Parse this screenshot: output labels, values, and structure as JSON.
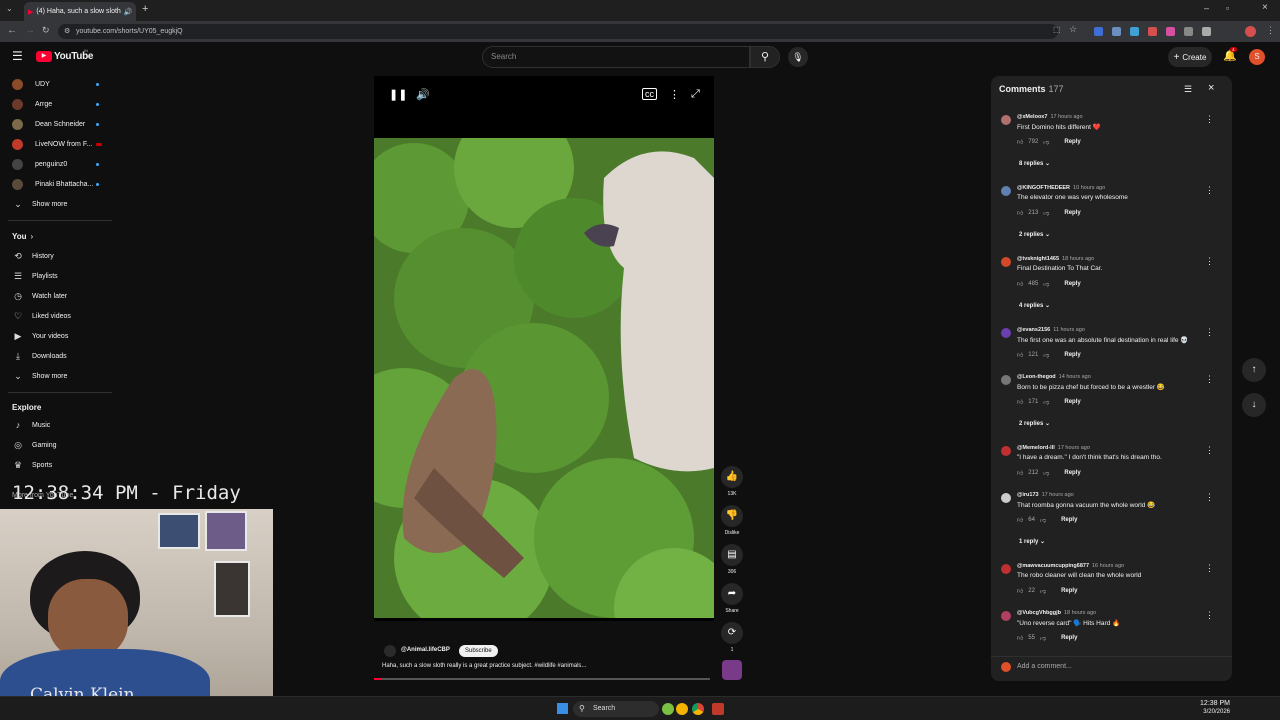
{
  "browser": {
    "tab_title": "(4) Haha, such a slow sloth",
    "url": "youtube.com/shorts/UY05_eugkjQ"
  },
  "header": {
    "logo": "YouTube",
    "logo_badge": "IN",
    "search_placeholder": "Search",
    "create_label": "Create",
    "notification_count": "4",
    "avatar_letter": "S"
  },
  "sidebar": {
    "subscriptions": [
      {
        "label": "UDY",
        "color": "#8a4b2a"
      },
      {
        "label": "Arrge",
        "color": "#6b3a2a"
      },
      {
        "label": "Dean Schneider",
        "color": "#7a6a4a"
      },
      {
        "label": "LiveNOW from F...",
        "color": "#c0392b"
      },
      {
        "label": "penguinz0",
        "color": "#444"
      },
      {
        "label": "Pinaki Bhattacha...",
        "color": "#5a4a3a"
      }
    ],
    "show_more_1": "Show more",
    "you_label": "You",
    "you_items": [
      {
        "label": "History",
        "icon": "history-icon",
        "glyph": "⟲"
      },
      {
        "label": "Playlists",
        "icon": "playlist-icon",
        "glyph": "☰"
      },
      {
        "label": "Watch later",
        "icon": "clock-icon",
        "glyph": "◷"
      },
      {
        "label": "Liked videos",
        "icon": "like-icon",
        "glyph": "👍"
      },
      {
        "label": "Your videos",
        "icon": "video-icon",
        "glyph": "▶"
      },
      {
        "label": "Downloads",
        "icon": "download-icon",
        "glyph": "⤓"
      }
    ],
    "show_more_2": "Show more",
    "explore_label": "Explore",
    "explore_items": [
      {
        "label": "Music",
        "icon": "music-icon",
        "glyph": "♪"
      },
      {
        "label": "Gaming",
        "icon": "gaming-icon",
        "glyph": "◎"
      },
      {
        "label": "Sports",
        "icon": "trophy-icon",
        "glyph": "🏆"
      }
    ],
    "more_from": "More from YouTube"
  },
  "overlay": {
    "clock": "12:38:34 PM - Friday",
    "webcam_shirt": "Calvin Klein"
  },
  "short": {
    "channel": "@Animal.lifeCBP",
    "subscribe_label": "Subscribe",
    "caption": "Haha, such a slow sloth really is a great practice subject. #wildlife #animals...",
    "progress": 0.02
  },
  "actions": {
    "likes": "13K",
    "dislike_label": "Dislike",
    "comments": "306",
    "share_label": "Share",
    "remix_count": "1"
  },
  "comments": {
    "title": "Comments",
    "count": "177",
    "add_placeholder": "Add a comment...",
    "items": [
      {
        "author": "@xMeloox7",
        "time": "17 hours ago",
        "text": "First Domino hits different ❤️",
        "likes": "792",
        "avatar_color": "#b07070",
        "replies": "8 replies"
      },
      {
        "author": "@KINGOFTHEDEER",
        "time": "10 hours ago",
        "text": "The elevator one was very wholesome",
        "likes": "213",
        "avatar_color": "#6080b0",
        "replies": "2 replies"
      },
      {
        "author": "@tvsknight1465",
        "time": "18 hours ago",
        "text": "Final Destination To That Car.",
        "likes": "485",
        "avatar_color": "#d04a2a",
        "replies": "4 replies"
      },
      {
        "author": "@evans2156",
        "time": "11 hours ago",
        "text": "The first one was an absolute final destination in real life 💀",
        "likes": "121",
        "avatar_color": "#6a3fb0",
        "replies": ""
      },
      {
        "author": "@Leon-thegod",
        "time": "14 hours ago",
        "text": "Born to be pizza chef but forced to be a wrestler 😂",
        "likes": "171",
        "avatar_color": "#777777",
        "replies": "2 replies"
      },
      {
        "author": "@Memelord-lll",
        "time": "17 hours ago",
        "text": "\"I have a dream.\" I don't think that's his dream tho.",
        "likes": "212",
        "avatar_color": "#c03030",
        "replies": ""
      },
      {
        "author": "@iru173",
        "time": "17 hours ago",
        "text": "That roomba gonna vacuum the whole world 😂",
        "likes": "64",
        "avatar_color": "#cccccc",
        "replies": "1 reply"
      },
      {
        "author": "@mawvacuumcupping6877",
        "time": "16 hours ago",
        "text": "The robo cleaner will clean the whole world",
        "likes": "22",
        "avatar_color": "#c03030",
        "replies": ""
      },
      {
        "author": "@VubcgVhbggjb",
        "time": "18 hours ago",
        "text": "\"Uno reverse card\" 🗣️ Hits Hard 🔥",
        "likes": "55",
        "avatar_color": "#b04060",
        "replies": ""
      }
    ],
    "reply_label": "Reply"
  },
  "taskbar": {
    "search_label": "Search",
    "time": "12:38 PM",
    "date": "3/20/2026"
  }
}
